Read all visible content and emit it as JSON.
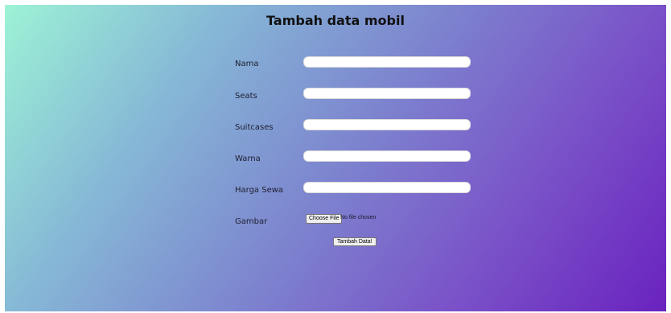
{
  "page": {
    "title": "Tambah data mobil"
  },
  "form": {
    "fields": [
      {
        "label": "Nama",
        "value": ""
      },
      {
        "label": "Seats",
        "value": ""
      },
      {
        "label": "Suitcases",
        "value": ""
      },
      {
        "label": "Warna",
        "value": ""
      },
      {
        "label": "Harga Sewa",
        "value": ""
      }
    ],
    "image": {
      "label": "Gambar",
      "choose_label": "Choose File",
      "status": "No file chosen"
    },
    "submit_label": "Tambah Data!"
  },
  "colors": {
    "gradient_start": "#9df3d6",
    "gradient_mid": "#7d86cf",
    "gradient_end": "#6a22bf"
  }
}
